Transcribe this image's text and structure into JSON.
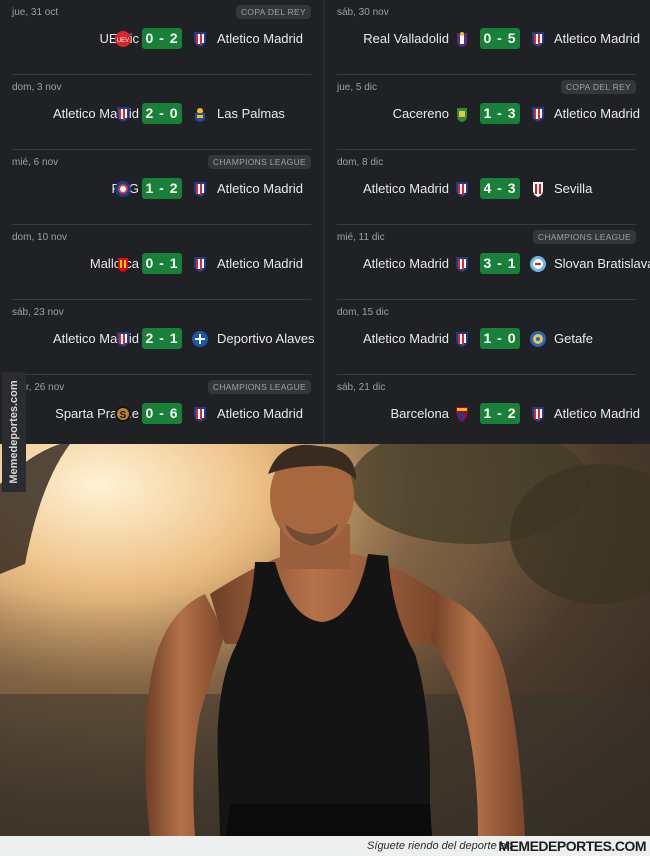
{
  "results": {
    "left": [
      {
        "date": "jue, 31 oct",
        "competition": "COPA DEL REY",
        "home": "UE Vic",
        "home_crest": "ue-vic-crest",
        "score": "0 - 2",
        "away": "Atletico Madrid",
        "away_crest": "atletico-crest"
      },
      {
        "date": "dom, 3 nov",
        "competition": "",
        "home": "Atletico Madrid",
        "home_crest": "atletico-crest",
        "score": "2 - 0",
        "away": "Las Palmas",
        "away_crest": "las-palmas-crest"
      },
      {
        "date": "mié, 6 nov",
        "competition": "CHAMPIONS LEAGUE",
        "home": "PSG",
        "home_crest": "psg-crest",
        "score": "1 - 2",
        "away": "Atletico Madrid",
        "away_crest": "atletico-crest"
      },
      {
        "date": "dom, 10 nov",
        "competition": "",
        "home": "Mallorca",
        "home_crest": "mallorca-crest",
        "score": "0 - 1",
        "away": "Atletico Madrid",
        "away_crest": "atletico-crest"
      },
      {
        "date": "sáb, 23 nov",
        "competition": "",
        "home": "Atletico Madrid",
        "home_crest": "atletico-crest",
        "score": "2 - 1",
        "away": "Deportivo Alaves",
        "away_crest": "alaves-crest"
      },
      {
        "date": "mar, 26 nov",
        "competition": "CHAMPIONS LEAGUE",
        "home": "Sparta Prague",
        "home_crest": "sparta-crest",
        "score": "0 - 6",
        "away": "Atletico Madrid",
        "away_crest": "atletico-crest"
      }
    ],
    "right": [
      {
        "date": "sáb, 30 nov",
        "competition": "",
        "home": "Real Valladolid",
        "home_crest": "valladolid-crest",
        "score": "0 - 5",
        "away": "Atletico Madrid",
        "away_crest": "atletico-crest"
      },
      {
        "date": "jue, 5 dic",
        "competition": "COPA DEL REY",
        "home": "Cacereno",
        "home_crest": "cacereno-crest",
        "score": "1 - 3",
        "away": "Atletico Madrid",
        "away_crest": "atletico-crest"
      },
      {
        "date": "dom, 8 dic",
        "competition": "",
        "home": "Atletico Madrid",
        "home_crest": "atletico-crest",
        "score": "4 - 3",
        "away": "Sevilla",
        "away_crest": "sevilla-crest"
      },
      {
        "date": "mié, 11 dic",
        "competition": "CHAMPIONS LEAGUE",
        "home": "Atletico Madrid",
        "home_crest": "atletico-crest",
        "score": "3 - 1",
        "away": "Slovan Bratislava",
        "away_crest": "slovan-crest"
      },
      {
        "date": "dom, 15 dic",
        "competition": "",
        "home": "Atletico Madrid",
        "home_crest": "atletico-crest",
        "score": "1 - 0",
        "away": "Getafe",
        "away_crest": "getafe-crest"
      },
      {
        "date": "sáb, 21 dic",
        "competition": "",
        "home": "Barcelona",
        "home_crest": "barcelona-crest",
        "score": "1 - 2",
        "away": "Atletico Madrid",
        "away_crest": "atletico-crest"
      }
    ]
  },
  "watermark": "Memedeportes.com",
  "footer": {
    "text": "Síguete riendo del deporte en",
    "logo": "MEMEDEPORTES.COM"
  },
  "colors": {
    "background": "#202124",
    "score_win": "#188038",
    "text": "#e8eaed",
    "muted": "#9aa0a6"
  }
}
